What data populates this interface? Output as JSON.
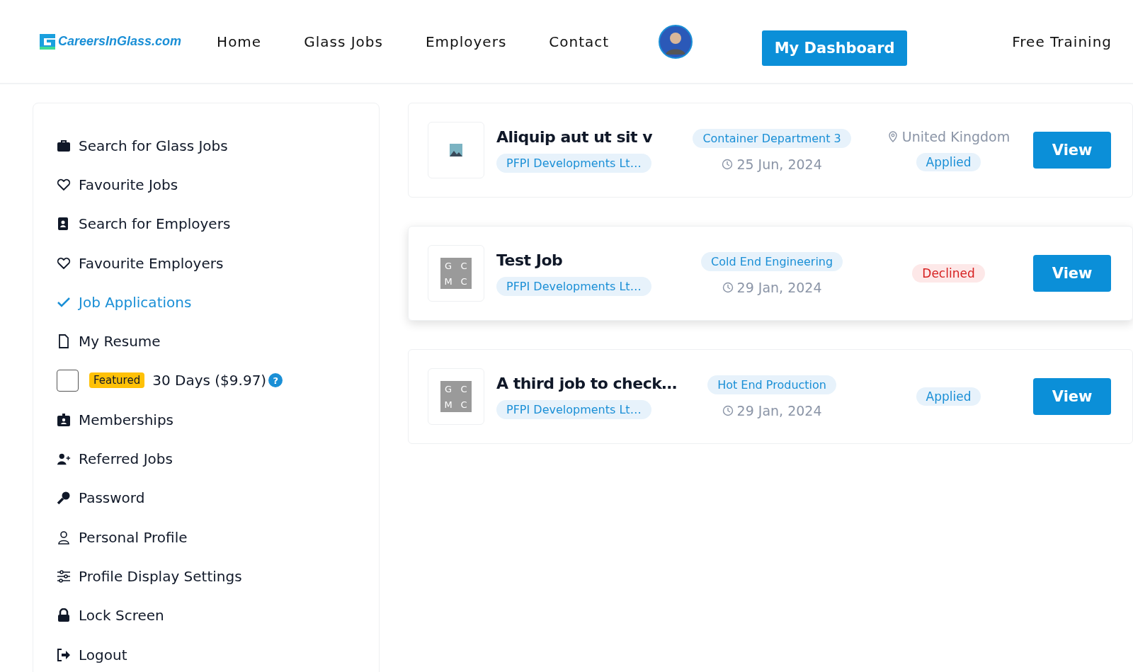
{
  "header": {
    "logo": "CareersInGlass.com",
    "nav": [
      {
        "label": "Home"
      },
      {
        "label": "Glass Jobs"
      },
      {
        "label": "Employers"
      },
      {
        "label": "Contact"
      }
    ],
    "dashboard_button": "My Dashboard",
    "free_training": "Free Training"
  },
  "sidebar": {
    "items": [
      {
        "kind": "link",
        "label": "Search for Glass Jobs",
        "selected": false
      },
      {
        "kind": "link",
        "label": "Favourite Jobs",
        "selected": false
      },
      {
        "kind": "link",
        "label": "Search for Employers",
        "selected": false
      },
      {
        "kind": "link",
        "label": "Favourite Employers",
        "selected": false
      },
      {
        "kind": "link",
        "label": "Job Applications",
        "selected": true
      },
      {
        "kind": "link",
        "label": "My Resume",
        "selected": false
      },
      {
        "kind": "checkbox",
        "badge": "Featured",
        "label": "30 Days ($9.97)",
        "checked": false,
        "help": "?"
      },
      {
        "kind": "link",
        "label": "Memberships",
        "selected": false
      },
      {
        "kind": "link",
        "label": "Referred Jobs",
        "selected": false
      },
      {
        "kind": "link",
        "label": "Password",
        "selected": false
      },
      {
        "kind": "link",
        "label": "Personal Profile",
        "selected": false
      },
      {
        "kind": "link",
        "label": "Profile Display Settings",
        "selected": false
      },
      {
        "kind": "link",
        "label": "Lock Screen",
        "selected": false
      },
      {
        "kind": "link",
        "label": "Logout",
        "selected": false
      }
    ]
  },
  "applications": [
    {
      "logo": {
        "kind": "image"
      },
      "title": "Aliquip aut ut sit v",
      "company": "PFPI Developments Lt…",
      "department": "Container Department 3",
      "date": "25 Jun, 2024",
      "location": "United Kingdom",
      "status": {
        "kind": "applied",
        "label": "Applied"
      },
      "highlighted": false,
      "button": "View"
    },
    {
      "logo": {
        "kind": "letters",
        "letters": [
          "G",
          "C",
          "M",
          "C"
        ]
      },
      "title": "Test Job",
      "company": "PFPI Developments Lt…",
      "department": "Cold End Engineering",
      "date": "29 Jan, 2024",
      "status": {
        "kind": "declined",
        "label": "Declined"
      },
      "highlighted": true,
      "button": "View"
    },
    {
      "logo": {
        "kind": "letters",
        "letters": [
          "G",
          "C",
          "M",
          "C"
        ]
      },
      "title": "A third job to check…",
      "company": "PFPI Developments Lt…",
      "department": "Hot End Production",
      "date": "29 Jan, 2024",
      "status": {
        "kind": "applied",
        "label": "Applied"
      },
      "highlighted": false,
      "button": "View"
    }
  ]
}
